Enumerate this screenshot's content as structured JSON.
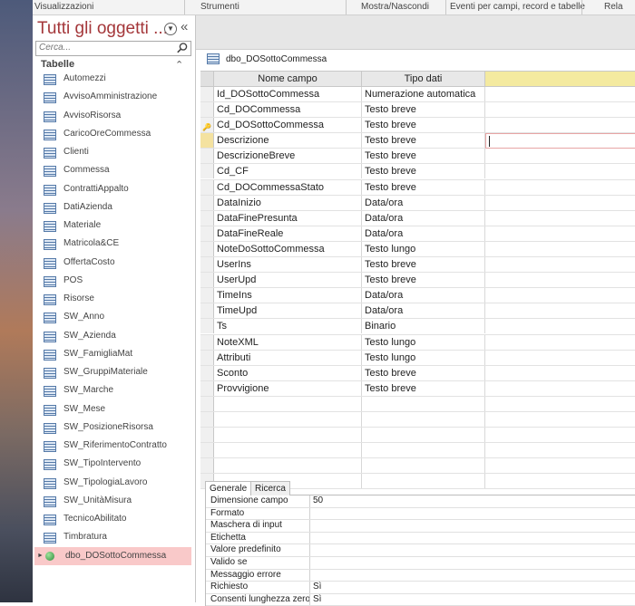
{
  "ribbon": {
    "groups": [
      "Visualizzazioni",
      "Strumenti",
      "Mostra/Nascondi",
      "Eventi per campi, record e tabelle",
      "Rela"
    ]
  },
  "nav": {
    "title": "Tutti gli oggetti ...",
    "search_placeholder": "Cerca...",
    "group_header": "Tabelle",
    "items": [
      "Automezzi",
      "AvvisoAmministrazione",
      "AvvisoRisorsa",
      "CaricoOreCommessa",
      "Clienti",
      "Commessa",
      "ContrattiAppalto",
      "DatiAzienda",
      "Materiale",
      "Matricola&CE",
      "OffertaCosto",
      "POS",
      "Risorse",
      "SW_Anno",
      "SW_Azienda",
      "SW_FamigliaMat",
      "SW_GruppiMateriale",
      "SW_Marche",
      "SW_Mese",
      "SW_PosizioneRisorsa",
      "SW_RiferimentoContratto",
      "SW_TipoIntervento",
      "SW_TipologiaLavoro",
      "SW_UnitàMisura",
      "TecnicoAbilitato",
      "Timbratura"
    ],
    "selected_item": "dbo_DOSottoCommessa"
  },
  "doc_tab": {
    "label": "dbo_DOSottoCommessa"
  },
  "grid": {
    "headers": [
      "Nome campo",
      "Tipo dati"
    ],
    "rows": [
      [
        "Id_DOSottoCommessa",
        "Numerazione automatica"
      ],
      [
        "Cd_DOCommessa",
        "Testo breve"
      ],
      [
        "Cd_DOSottoCommessa",
        "Testo breve"
      ],
      [
        "Descrizione",
        "Testo breve"
      ],
      [
        "DescrizioneBreve",
        "Testo breve"
      ],
      [
        "Cd_CF",
        "Testo breve"
      ],
      [
        "Cd_DOCommessaStato",
        "Testo breve"
      ],
      [
        "DataInizio",
        "Data/ora"
      ],
      [
        "DataFinePresunta",
        "Data/ora"
      ],
      [
        "DataFineReale",
        "Data/ora"
      ],
      [
        "NoteDoSottoCommessa",
        "Testo lungo"
      ],
      [
        "UserIns",
        "Testo breve"
      ],
      [
        "UserUpd",
        "Testo breve"
      ],
      [
        "TimeIns",
        "Data/ora"
      ],
      [
        "TimeUpd",
        "Data/ora"
      ],
      [
        "Ts",
        "Binario"
      ],
      [
        "NoteXML",
        "Testo lungo"
      ],
      [
        "Attributi",
        "Testo lungo"
      ],
      [
        "Sconto",
        "Testo breve"
      ],
      [
        "Provvigione",
        "Testo breve"
      ],
      [
        "",
        ""
      ],
      [
        "",
        ""
      ],
      [
        "",
        ""
      ],
      [
        "",
        ""
      ],
      [
        "",
        ""
      ],
      [
        "",
        ""
      ]
    ]
  },
  "props": {
    "tabs": [
      "Generale",
      "Ricerca"
    ],
    "rows": [
      [
        "Dimensione campo",
        "50"
      ],
      [
        "Formato",
        ""
      ],
      [
        "Maschera di input",
        ""
      ],
      [
        "Etichetta",
        ""
      ],
      [
        "Valore predefinito",
        ""
      ],
      [
        "Valido se",
        ""
      ],
      [
        "Messaggio errore",
        ""
      ],
      [
        "Richiesto",
        "Sì"
      ],
      [
        "Consenti lunghezza zero",
        "Sì"
      ]
    ]
  }
}
